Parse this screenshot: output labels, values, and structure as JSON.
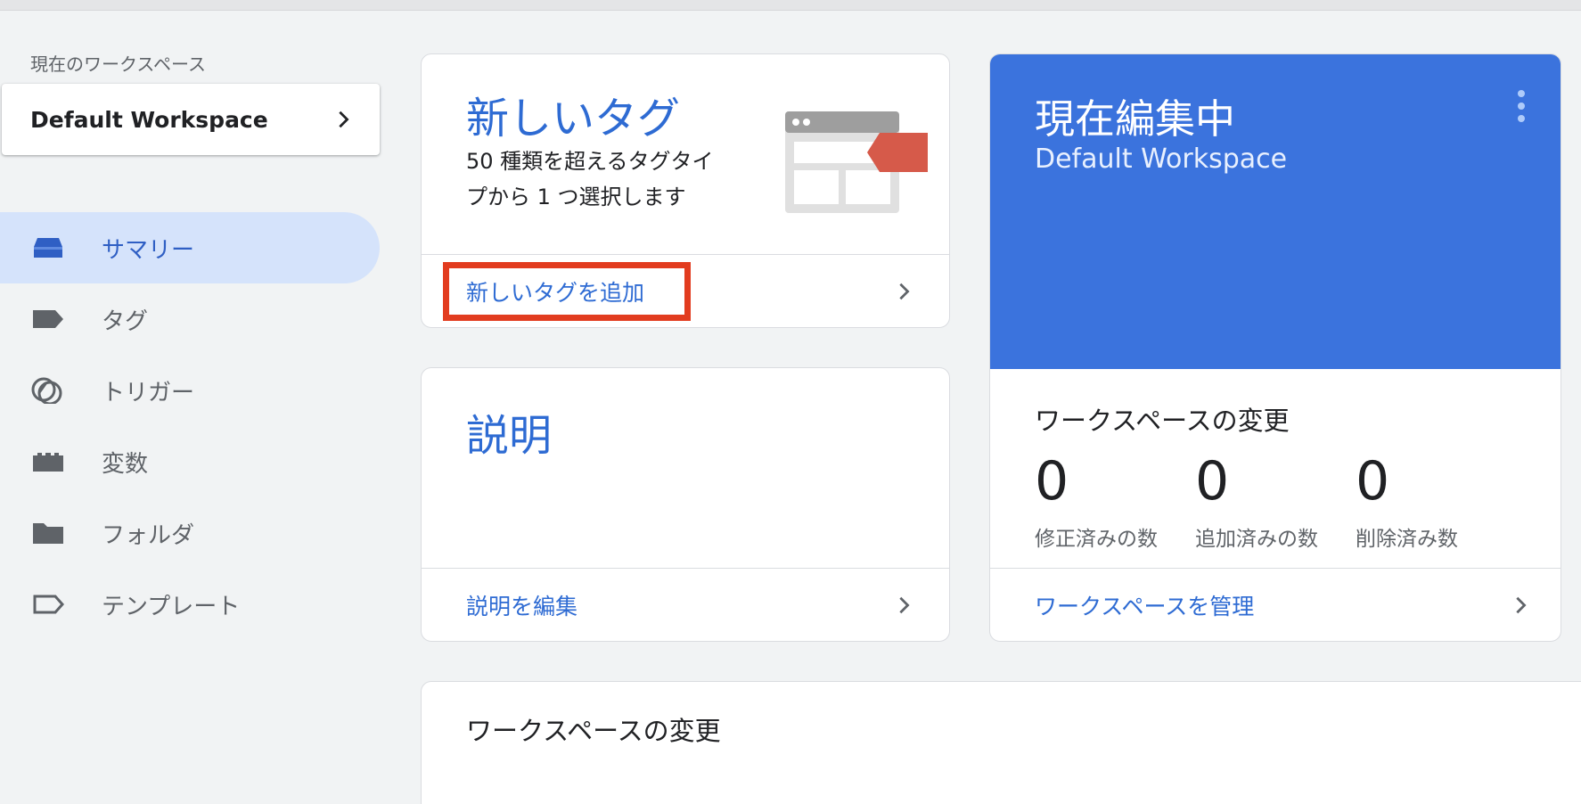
{
  "sidebar": {
    "workspace_caption": "現在のワークスペース",
    "workspace_name": "Default Workspace",
    "items": [
      {
        "label": "サマリー",
        "icon": "summary-icon",
        "active": true
      },
      {
        "label": "タグ",
        "icon": "tag-icon",
        "active": false
      },
      {
        "label": "トリガー",
        "icon": "trigger-icon",
        "active": false
      },
      {
        "label": "変数",
        "icon": "variable-icon",
        "active": false
      },
      {
        "label": "フォルダ",
        "icon": "folder-icon",
        "active": false
      },
      {
        "label": "テンプレート",
        "icon": "template-icon",
        "active": false
      }
    ]
  },
  "new_tag_card": {
    "title": "新しいタグ",
    "description": "50 種類を超えるタグタイプから 1 つ選択します",
    "link": "新しいタグを追加",
    "illustration": "new-tag-illustration"
  },
  "description_card": {
    "title": "説明",
    "link": "説明を編集"
  },
  "editing_card": {
    "title": "現在編集中",
    "workspace": "Default Workspace",
    "changes_title": "ワークスペースの変更",
    "stats": [
      {
        "value": "0",
        "label": "修正済みの数"
      },
      {
        "value": "0",
        "label": "追加済みの数"
      },
      {
        "value": "0",
        "label": "削除済み数"
      }
    ],
    "link": "ワークスペースを管理"
  },
  "workspace_changes_card": {
    "title": "ワークスペースの変更"
  },
  "colors": {
    "accent": "#2e6bd3",
    "header_blue": "#3b73dd",
    "active_nav_bg": "#d5e3fb",
    "highlight": "#e23c1f"
  }
}
